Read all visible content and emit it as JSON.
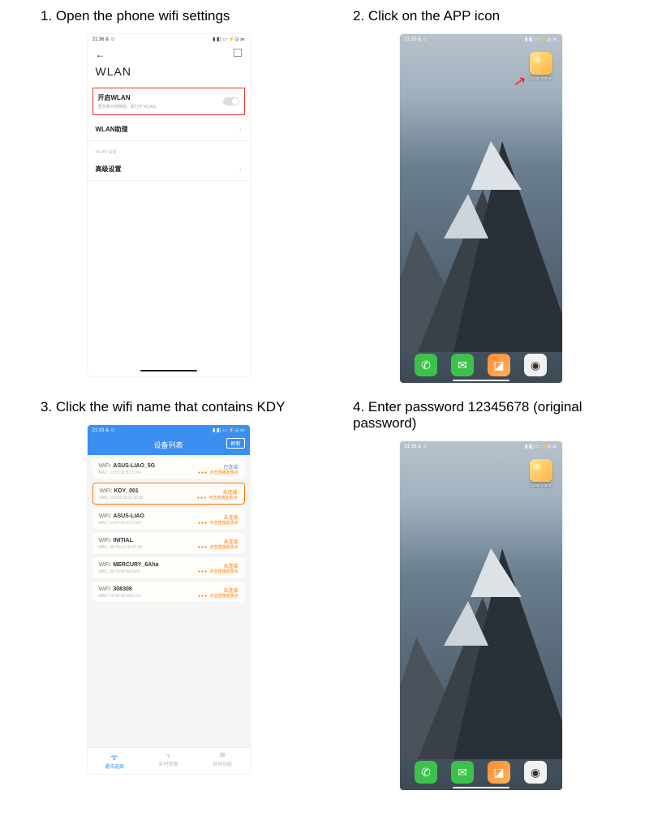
{
  "steps": {
    "s1": "1. Open the phone wifi settings",
    "s2": "2. Click on the APP icon",
    "s3": "3. Click the wifi name that contains KDY",
    "s4": "4. Enter password 12345678 (original password)"
  },
  "statusbar": {
    "time1": "21:36 & ☺",
    "time2": "21:35 & ☺",
    "time3": "21:03 & ☺",
    "time4": "21:35 & ☺",
    "icons": "▮ ◧ ▭ ⚡◶ ⫘"
  },
  "wlan": {
    "title": "WLAN",
    "open_label": "开启WLAN",
    "open_sub": "要查看可用网络，请打开 WLAN。",
    "assist": "WLAN助理",
    "section": "WLAN 设置",
    "advanced": "高级设置"
  },
  "home": {
    "app_label": "Solar online"
  },
  "wifiapp": {
    "header": "设备列表",
    "refresh": "刷新",
    "items": [
      {
        "name": "ASUS-LIAO_5G",
        "mac": "MAC: 1c:b7:2c:f0:71:64",
        "status": "已连接",
        "status_class": "blue",
        "hint": "点击连接此热点"
      },
      {
        "name": "KDY_001",
        "mac": "MAC: 2a:6d:cd:da:30:d0",
        "status": "未连接",
        "status_class": "orange",
        "hint": "点击连接此热点",
        "selected": true
      },
      {
        "name": "ASUS-LIAO",
        "mac": "MAC: 1c:b7:2c:f0:71:60",
        "status": "未连接",
        "status_class": "orange",
        "hint": "点击连接此热点"
      },
      {
        "name": "INITIAL",
        "mac": "MAC: 60:76:a7:3c:07:90",
        "status": "未连接",
        "status_class": "orange",
        "hint": "点击连接此热点"
      },
      {
        "name": "MERCURY_6Aha",
        "mac": "MAC: 90:76:9f:4d:6a:f1",
        "status": "未连接",
        "status_class": "orange",
        "hint": "点击连接此热点"
      },
      {
        "name": "308308",
        "mac": "MAC: c8:5b:a0:5f:5c:c0",
        "status": "未连接",
        "status_class": "orange",
        "hint": "点击连接此热点"
      }
    ],
    "tabs": {
      "t1": "通讯选择",
      "t2": "实时数据",
      "t3": "其他功能"
    }
  }
}
